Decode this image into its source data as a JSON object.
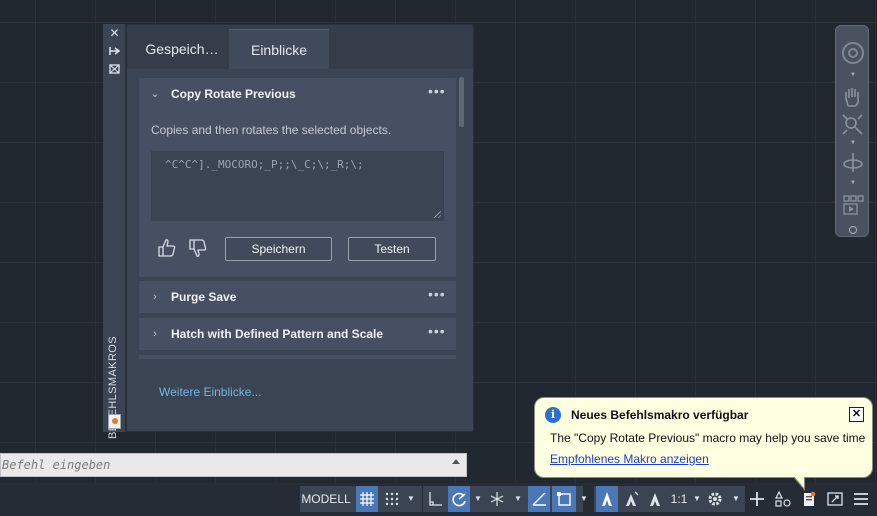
{
  "palette": {
    "side_title": "BEFEHLSMAKROS",
    "tabs": [
      "Gespeich…",
      "Einblicke"
    ],
    "active_tab": "Einblicke",
    "expanded_macro": {
      "title": "Copy Rotate Previous",
      "description": "Copies and then rotates the selected objects.",
      "macro_text": "^C^C^]._MOCORO;_P;;\\_C;\\;_R;\\;",
      "save_label": "Speichern",
      "test_label": "Testen"
    },
    "macros": [
      "Purge Save",
      "Hatch with Defined Pattern and Scale"
    ],
    "more_link": "Weitere Einblicke..."
  },
  "command_line": {
    "placeholder": "Befehl eingeben"
  },
  "statusbar": {
    "model": "MODELL",
    "scale": "1:1"
  },
  "notification": {
    "title": "Neues Befehlsmakro verfügbar",
    "message": "The \"Copy Rotate Previous\" macro may help you save time",
    "link": "Empfohlenes Makro anzeigen"
  },
  "colors": {
    "accent": "#4a77b5",
    "link": "#6fb6e6",
    "balloon": "#ffffe1"
  }
}
